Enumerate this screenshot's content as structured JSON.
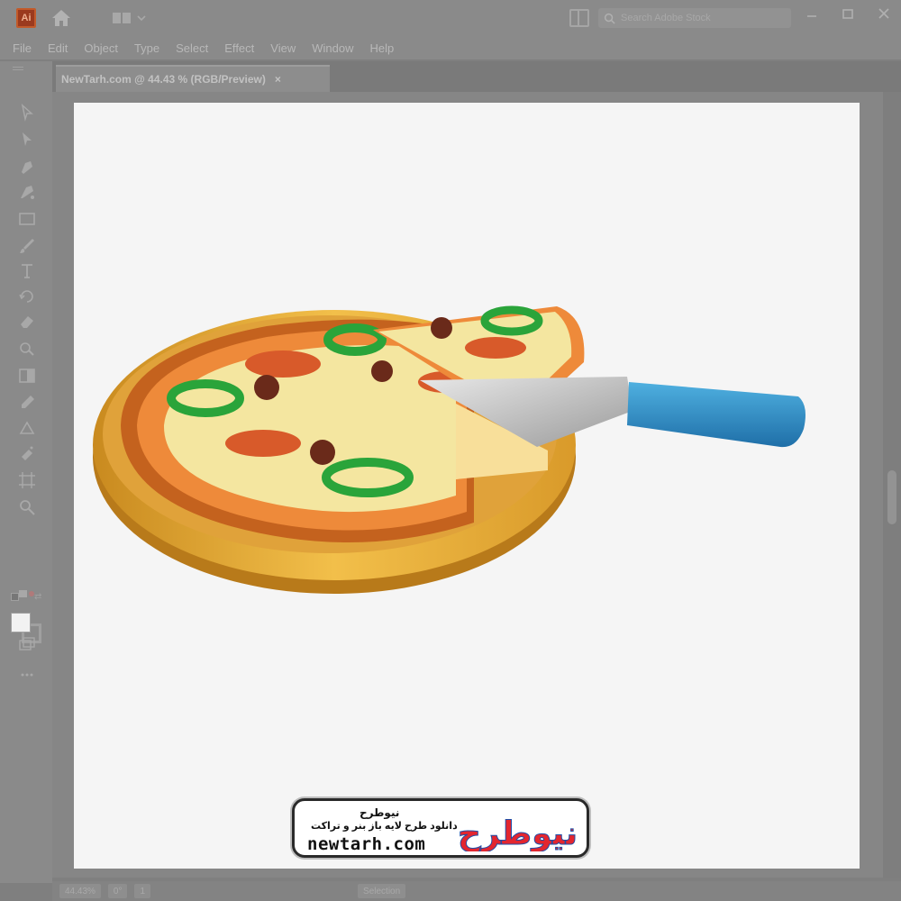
{
  "app": {
    "logo_text": "Ai",
    "search": {
      "placeholder": "Search Adobe Stock"
    }
  },
  "menu": {
    "items": [
      "File",
      "Edit",
      "Object",
      "Type",
      "Select",
      "Effect",
      "View",
      "Window",
      "Help"
    ]
  },
  "document": {
    "tab_title": "NewTarh.com @ 44.43 % (RGB/Preview)",
    "tab_close": "×"
  },
  "status": {
    "zoom": "44.43%",
    "rotation": "0°",
    "artboard_number": "1",
    "tool": "Selection"
  },
  "watermark": {
    "brand_fa": "نیوطرح",
    "tagline_fa": "دانلود طرح لایه باز بنر و تراکت",
    "url": "newtarh.com",
    "logo_fa": "نیوطرح"
  },
  "colors": {
    "chrome": "#8a8a8a",
    "artboard": "#f5f5f5",
    "logo_red": "#e3262f",
    "logo_blue": "#1f4fa8",
    "spatula_blue": "#2f8fc6",
    "crust_orange": "#e9822c",
    "board_gold": "#e8a93a",
    "cheese": "#f6eaa6",
    "pepper_green": "#2aa43a",
    "pepperoni": "#e9703a"
  }
}
